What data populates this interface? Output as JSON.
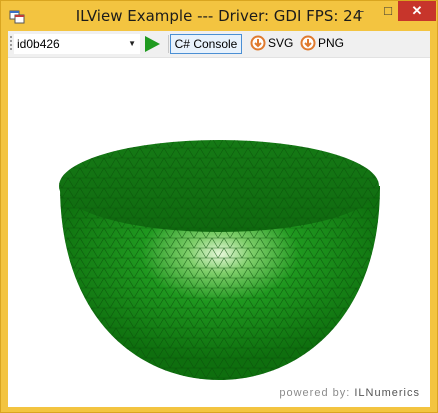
{
  "window": {
    "title": "ILView Example --- Driver: GDI  FPS: 24",
    "controls": {
      "minimize": "–",
      "maximize": "□",
      "close": "✕"
    }
  },
  "toolbar": {
    "combo_value": "id0b426",
    "console_label": "C# Console",
    "svg_label": "SVG",
    "png_label": "PNG"
  },
  "plot": {
    "powered_prefix": "powered by:",
    "powered_brand": "ILNumerics",
    "surface_color": "#1a8c1a",
    "mesh_color": "#0a4d0a"
  },
  "colors": {
    "frame": "#f3c440",
    "close": "#c7352b",
    "play": "#1f9a1f",
    "download": "#e07a2e"
  }
}
